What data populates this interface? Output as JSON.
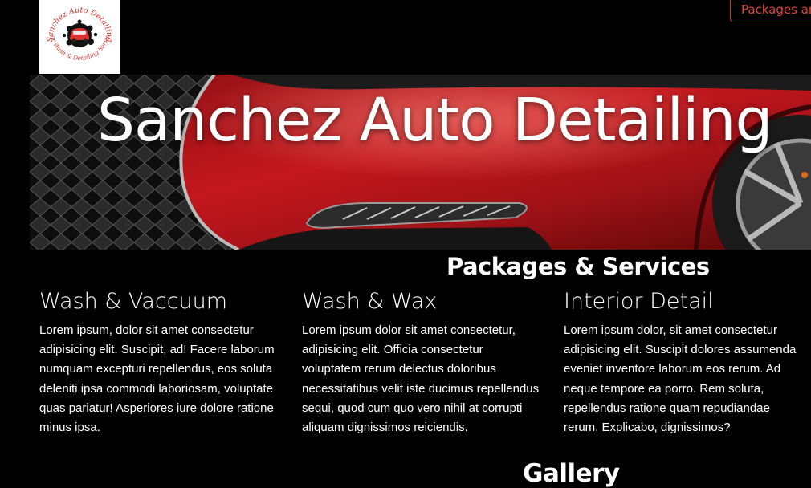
{
  "logo": {
    "top_text": "Sanchez Auto Detailing",
    "bottom_text": "Car Wash & Detailing Service",
    "icon": "car-icon"
  },
  "nav": {
    "packages_label": "Packages and Services"
  },
  "hero": {
    "title": "Sanchez Auto Detailing",
    "image": "red-car-headlight-photo"
  },
  "packages": {
    "heading": "Packages & Services",
    "items": [
      {
        "title": "Wash & Vaccuum",
        "text": "Lorem ipsum, dolor sit amet consectetur adipisicing elit. Suscipit, ad! Facere laborum numquam excepturi repellendus, eos soluta deleniti ipsa commodi laboriosam, voluptate quas pariatur! Asperiores iure dolore ratione minus ipsa."
      },
      {
        "title": "Wash & Wax",
        "text": "Lorem ipsum dolor sit amet consectetur, adipisicing elit. Officia consectetur voluptatem rerum delectus doloribus necessitatibus velit iste ducimus repellendus sequi, quod cum quo vero nihil at corrupti aliquam dignissimos reiciendis."
      },
      {
        "title": "Interior Detail",
        "text": "Lorem ipsum dolor, sit amet consectetur adipisicing elit. Suscipit dolores assumenda eveniet inventore laborum eos rerum. Ad neque tempore ea porro. Rem soluta, repellendus ratione quam repudiandae rerum. Explicabo, dignissimos?"
      }
    ]
  },
  "gallery": {
    "heading": "Gallery"
  },
  "colors": {
    "background": "#000000",
    "accent": "#c0392b",
    "text": "#ffffff"
  }
}
